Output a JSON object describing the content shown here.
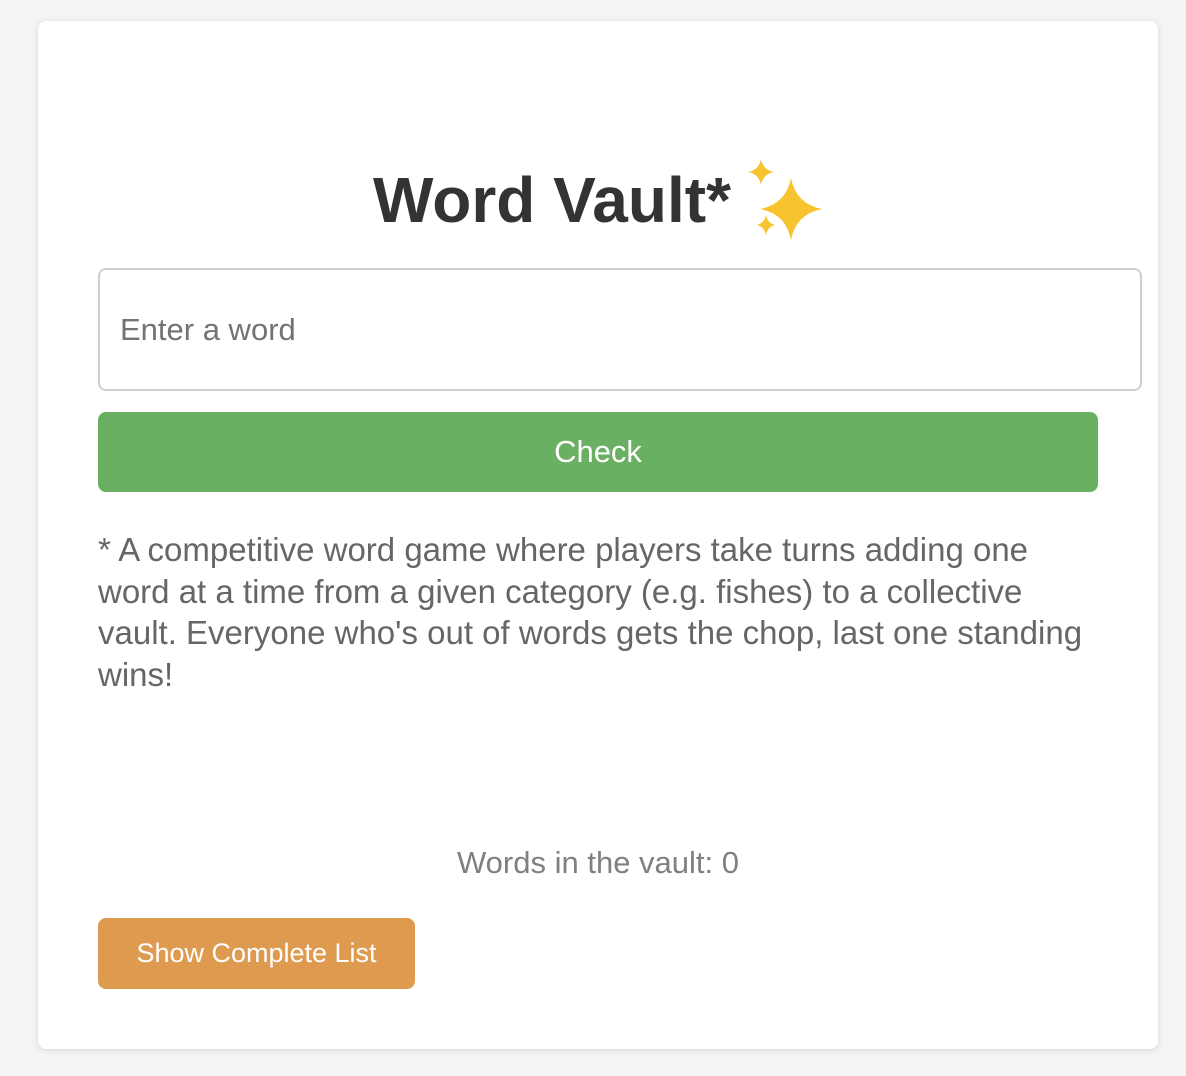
{
  "app": {
    "title": "Word Vault*",
    "title_icon": "sparkles-icon"
  },
  "input": {
    "placeholder": "Enter a word",
    "value": ""
  },
  "check_button": {
    "label": "Check",
    "color": "#6ab063"
  },
  "description": "* A competitive word game where players take turns adding one word at a time from a given category (e.g. fishes) to a collective vault. Everyone who's out of words gets the chop, last one standing wins!",
  "vault": {
    "count_text": "Words in the vault: 0"
  },
  "show_list_button": {
    "label": "Show Complete List",
    "color": "#de9b4f"
  },
  "colors": {
    "background": "#f4f4f4",
    "card": "#ffffff",
    "title_text": "#333333",
    "sparkle": "#f7c32e"
  }
}
